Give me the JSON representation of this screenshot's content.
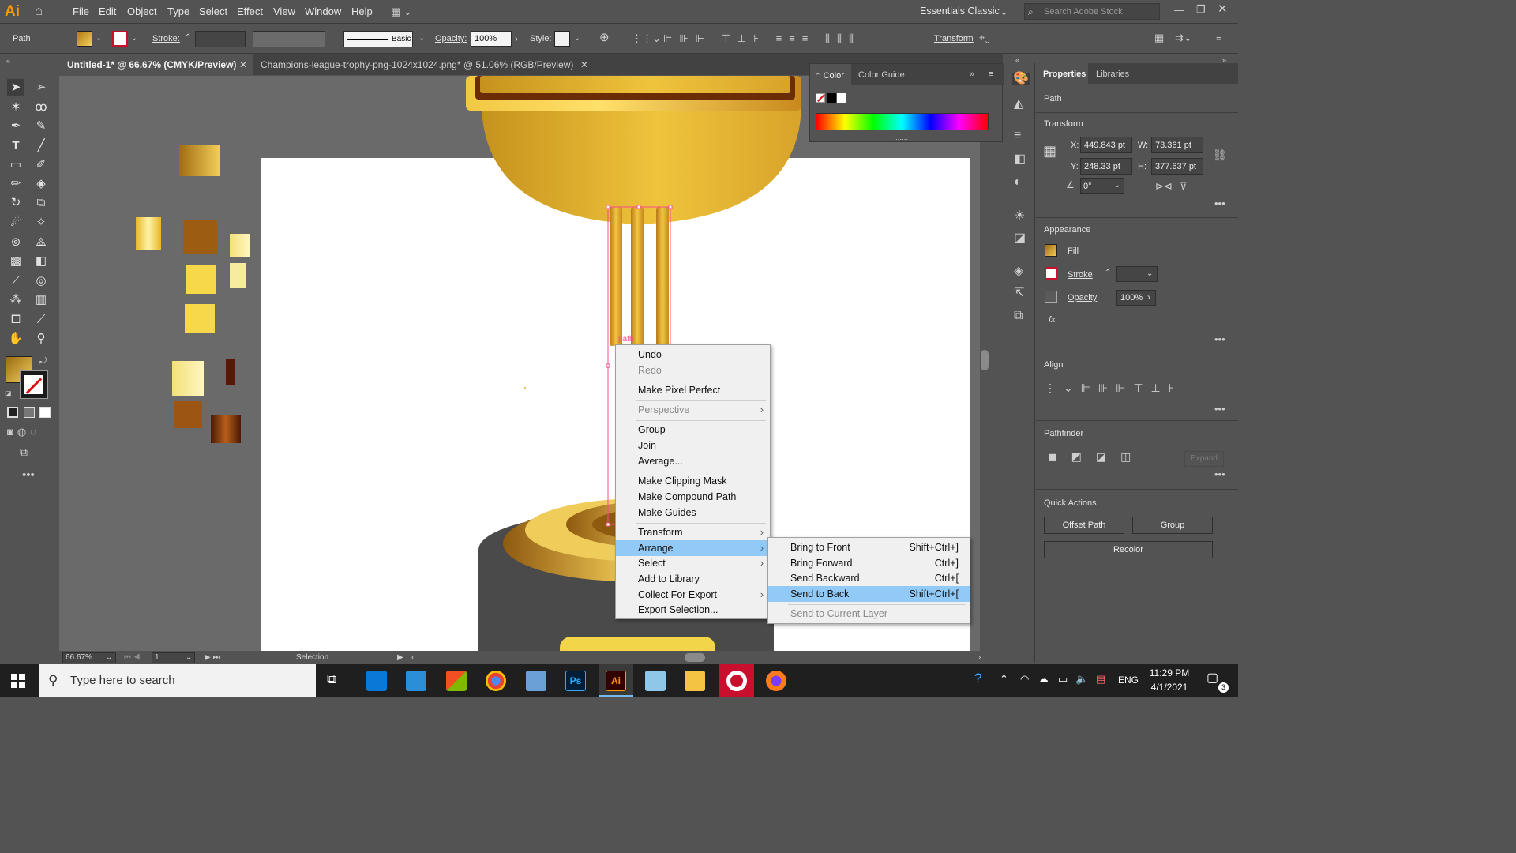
{
  "menubar": {
    "logo": "Ai",
    "menus": [
      "File",
      "Edit",
      "Object",
      "Type",
      "Select",
      "Effect",
      "View",
      "Window",
      "Help"
    ],
    "workspace": "Essentials Classic",
    "search_placeholder": "Search Adobe Stock"
  },
  "control_bar": {
    "selection_type": "Path",
    "stroke_label": "Stroke:",
    "brush_label": "Basic",
    "opacity_label": "Opacity:",
    "opacity_value": "100%",
    "style_label": "Style:",
    "transform_label": "Transform"
  },
  "tabs": [
    {
      "label": "Untitled-1* @ 66.67% (CMYK/Preview)",
      "active": true
    },
    {
      "label": "Champions-league-trophy-png-1024x1024.png* @ 51.06% (RGB/Preview)",
      "active": false
    }
  ],
  "color_panel": {
    "tabs": [
      "Color",
      "Color Guide"
    ]
  },
  "canvas": {
    "path_label": "path"
  },
  "properties": {
    "tabs": [
      "Properties",
      "Libraries"
    ],
    "object_type": "Path",
    "transform_title": "Transform",
    "x_label": "X:",
    "x_value": "449.843 pt",
    "y_label": "Y:",
    "y_value": "248.33 pt",
    "w_label": "W:",
    "w_value": "73.361 pt",
    "h_label": "H:",
    "h_value": "377.637 pt",
    "angle_value": "0°",
    "appearance_title": "Appearance",
    "fill_label": "Fill",
    "stroke_label": "Stroke",
    "opacity_label": "Opacity",
    "opacity_value": "100%",
    "fx_label": "fx.",
    "align_title": "Align",
    "pathfinder_title": "Pathfinder",
    "expand_label": "Expand",
    "quick_actions_title": "Quick Actions",
    "offset_path_label": "Offset Path",
    "group_label": "Group",
    "recolor_label": "Recolor"
  },
  "context_menu": {
    "items": [
      {
        "label": "Undo",
        "disabled": false
      },
      {
        "label": "Redo",
        "disabled": true
      },
      {
        "label": "Make Pixel Perfect",
        "disabled": false
      },
      {
        "label": "Perspective",
        "disabled": true,
        "submenu": true
      },
      {
        "label": "Group",
        "disabled": false
      },
      {
        "label": "Join",
        "disabled": false
      },
      {
        "label": "Average...",
        "disabled": false
      },
      {
        "label": "Make Clipping Mask",
        "disabled": false
      },
      {
        "label": "Make Compound Path",
        "disabled": false
      },
      {
        "label": "Make Guides",
        "disabled": false
      },
      {
        "label": "Transform",
        "disabled": false,
        "submenu": true
      },
      {
        "label": "Arrange",
        "disabled": false,
        "submenu": true,
        "highlighted": true
      },
      {
        "label": "Select",
        "disabled": false,
        "submenu": true
      },
      {
        "label": "Add to Library",
        "disabled": false
      },
      {
        "label": "Collect For Export",
        "disabled": false,
        "submenu": true
      },
      {
        "label": "Export Selection...",
        "disabled": false
      }
    ]
  },
  "arrange_submenu": {
    "items": [
      {
        "label": "Bring to Front",
        "shortcut": "Shift+Ctrl+]"
      },
      {
        "label": "Bring Forward",
        "shortcut": "Ctrl+]"
      },
      {
        "label": "Send Backward",
        "shortcut": "Ctrl+["
      },
      {
        "label": "Send to Back",
        "shortcut": "Shift+Ctrl+[",
        "highlighted": true
      },
      {
        "label": "Send to Current Layer",
        "shortcut": "",
        "disabled": true
      }
    ]
  },
  "statusbar": {
    "zoom": "66.67%",
    "artboard": "1",
    "mode": "Selection"
  },
  "taskbar": {
    "search_placeholder": "Type here to search",
    "language": "ENG",
    "time": "11:29 PM",
    "date": "4/1/2021",
    "notification_count": "3"
  },
  "colors": {
    "ui_bg": "#535353",
    "canvas_bg": "#6a6a6a",
    "highlight": "#91c9f7",
    "ai_orange": "#ff9a00",
    "gold": "#e2ad2a"
  }
}
